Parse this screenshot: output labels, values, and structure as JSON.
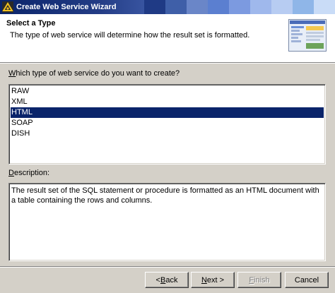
{
  "window": {
    "title": "Create Web Service Wizard",
    "titlebar_colors": [
      "#1f3a85",
      "#3f5fa8",
      "#6a86c8",
      "#5b7fd0",
      "#7c9ae0",
      "#9fb8ec",
      "#b7ccf2",
      "#8fb6e8",
      "#c9dcf7"
    ]
  },
  "header": {
    "title": "Select a Type",
    "subtitle": "The type of web service will determine how the result set is formatted.",
    "graphic_icon": "web-page-icon"
  },
  "type_prompt": {
    "mnemonic": "W",
    "rest": "hich type of web service do you want to create?"
  },
  "service_types": {
    "items": [
      "RAW",
      "XML",
      "HTML",
      "SOAP",
      "DISH"
    ],
    "selected": "HTML",
    "selected_index": 2
  },
  "description": {
    "label_mnemonic": "D",
    "label_rest": "escription:",
    "text": "The result set of the SQL statement or procedure is formatted as an HTML document with a table containing the rows and columns."
  },
  "buttons": {
    "back": {
      "mnemonic": "B",
      "prefix": "< ",
      "rest": "ack",
      "enabled": true
    },
    "next": {
      "mnemonic": "N",
      "prefix": "",
      "rest": "ext >",
      "enabled": true
    },
    "finish": {
      "mnemonic": "F",
      "prefix": "",
      "rest": "inish",
      "enabled": false
    },
    "cancel": {
      "label": "Cancel",
      "enabled": true
    }
  },
  "colors": {
    "selection": "#0a246a",
    "dialog_face": "#d4d0c8",
    "header_bg": "#ffffff"
  }
}
